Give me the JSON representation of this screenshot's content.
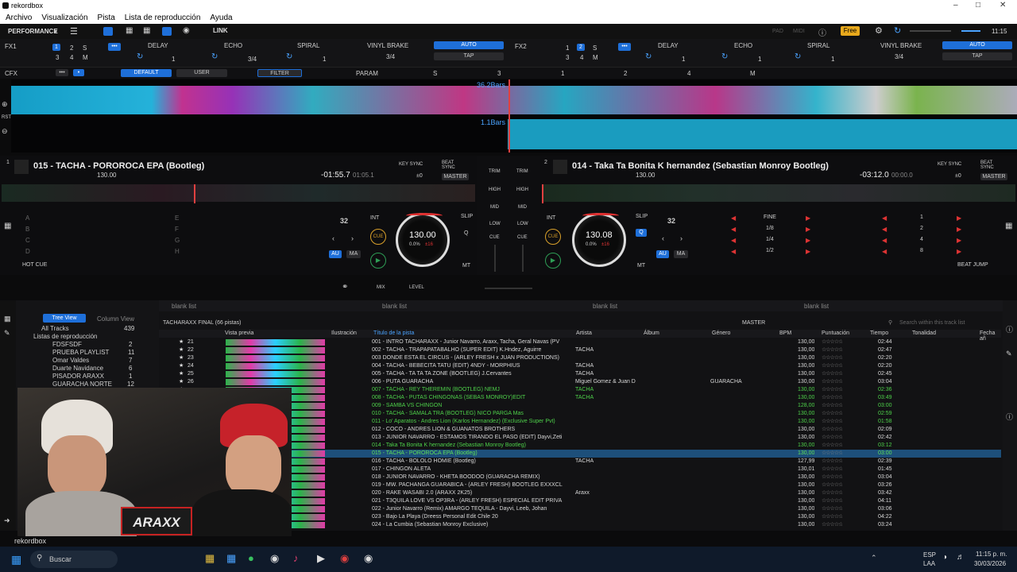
{
  "window": {
    "title": "rekordbox"
  },
  "menu": [
    "Archivo",
    "Visualización",
    "Pista",
    "Lista de reproducción",
    "Ayuda"
  ],
  "toolbar": {
    "mode": "PERFORMANCE",
    "link": "LINK",
    "pad": "PAD",
    "midi": "MIDI",
    "free": "Free",
    "time": "11:15"
  },
  "fx1": {
    "label": "FX1",
    "slots": [
      "DELAY",
      "ECHO",
      "SPIRAL"
    ],
    "beat": "3/4",
    "brake": "VINYL BRAKE",
    "auto": "AUTO",
    "tap": "TAP",
    "nums": [
      "1",
      "2",
      "S",
      "3",
      "4",
      "M"
    ],
    "vals": [
      "1",
      "3/4",
      "1"
    ]
  },
  "fx2": {
    "label": "FX2",
    "slots": [
      "DELAY",
      "ECHO",
      "SPIRAL"
    ],
    "beat": "3/4",
    "brake": "VINYL BRAKE",
    "auto": "AUTO",
    "tap": "TAP",
    "nums": [
      "1",
      "2",
      "S",
      "3",
      "4",
      "M"
    ],
    "vals": [
      "1",
      "1",
      "1"
    ]
  },
  "cfx": {
    "label": "CFX",
    "default": "DEFAULT",
    "user": "USER",
    "filter": "FILTER",
    "param": "PARAM",
    "s": "S",
    "n3": "3",
    "n1": "1",
    "n2": "2",
    "n4": "4",
    "m": "M"
  },
  "wave": {
    "bars1": "36.2Bars",
    "bars2": "1.1Bars",
    "rst": "RST"
  },
  "deckA": {
    "num": "1",
    "title": "015 - TACHA - POROROCA EPA (Bootleg)",
    "bpm": "130.00",
    "time": "-01:55.7",
    "time2": "01:05.1",
    "keysync": "KEY SYNC",
    "beatsync": "BEAT SYNC",
    "master": "MASTER",
    "key": "±0",
    "loop": "32",
    "int": "INT",
    "jog_bpm": "130.00",
    "jog_pct": "0.0%",
    "jog_range": "±16",
    "slip": "SLIP",
    "q": "Q",
    "cue": "CUE",
    "au": "AU",
    "ma": "MA",
    "mt": "MT",
    "hotcue": "HOT CUE",
    "pads": [
      "A",
      "B",
      "C",
      "D",
      "E",
      "F",
      "G",
      "H"
    ]
  },
  "deckB": {
    "num": "2",
    "title": "014 - Taka Ta Bonita K hernandez (Sebastian Monroy Bootleg)",
    "bpm": "130.00",
    "time": "-03:12.0",
    "time2": "00:00.0",
    "keysync": "KEY SYNC",
    "beatsync": "BEAT SYNC",
    "master": "MASTER",
    "key": "±0",
    "loop": "32",
    "int": "INT",
    "jog_bpm": "130.08",
    "jog_pct": "0.0%",
    "jog_range": "±16",
    "slip": "SLIP",
    "q": "Q",
    "cue": "CUE",
    "au": "AU",
    "ma": "MA",
    "mt": "MT",
    "beatjump": "BEAT JUMP",
    "jumps_left": [
      "FINE",
      "1/8",
      "1/4",
      "1/2"
    ],
    "jumps_right": [
      "1",
      "2",
      "4",
      "8"
    ]
  },
  "mixer": {
    "trim": "TRIM",
    "high": "HIGH",
    "mid": "MID",
    "low": "LOW",
    "cue": "CUE",
    "mix": "MIX",
    "level": "LEVEL"
  },
  "browser": {
    "tree_view": "Tree View",
    "column_view": "Column View",
    "tree": [
      {
        "name": "All Tracks",
        "count": "439"
      },
      {
        "name": "Listas de reproducción",
        "count": ""
      },
      {
        "name": "FDSFSDF",
        "count": "2"
      },
      {
        "name": "PRUEBA PLAYLIST",
        "count": "11"
      },
      {
        "name": "Omar Valdes",
        "count": "7"
      },
      {
        "name": "Duarte Navidance",
        "count": "6"
      },
      {
        "name": "PISADOR ARAXX",
        "count": "1"
      },
      {
        "name": "GUARACHA NORTE",
        "count": "12"
      }
    ],
    "panes": [
      "blank list",
      "blank list",
      "blank list",
      "blank list"
    ],
    "list_title": "TACHARAXX FINAL (66 pistas)",
    "master": "MASTER",
    "search": "Search within this track list",
    "cols": [
      "Vista previa",
      "Ilustración",
      "Título de la pista",
      "Artista",
      "Álbum",
      "Género",
      "BPM",
      "Puntuación",
      "Tiempo",
      "Tonalidad",
      "Fecha añ"
    ],
    "rows": [
      {
        "n": "21",
        "t": "001 - INTRO TACHARAXX - Junior Navarro, Araxx, Tacha, Geral Navas (PV",
        "a": "",
        "g": "",
        "b": "130,00",
        "d": "02:44",
        "c": ""
      },
      {
        "n": "22",
        "t": "002 - TACHA - TRAPAPATABALHO (SUPER EDIT) K.Hndez, Aguirre",
        "a": "TACHA",
        "g": "",
        "b": "130,00",
        "d": "02:47",
        "c": ""
      },
      {
        "n": "23",
        "t": "003 DONDE ESTA EL CIRCUS - (ARLEY FRESH x JUAN PRODUCTIONS)",
        "a": "",
        "g": "",
        "b": "130,00",
        "d": "02:20",
        "c": ""
      },
      {
        "n": "24",
        "t": "004 - TACHA - BEBECITA TATU (EDIT) 4NDY - MORPHIUS",
        "a": "TACHA",
        "g": "",
        "b": "130,00",
        "d": "02:20",
        "c": ""
      },
      {
        "n": "25",
        "t": "005 - TACHA - TA TA TA ZONE (BOOTLEG) J.Cervantes",
        "a": "TACHA",
        "g": "",
        "b": "130,00",
        "d": "02:45",
        "c": ""
      },
      {
        "n": "26",
        "t": "006 - PUTA GUARACHA",
        "a": "Miguel Gomez & Juan D",
        "g": "GUARACHA",
        "b": "130,00",
        "d": "03:04",
        "c": ""
      },
      {
        "n": "",
        "t": "007 - TACHA - REY THEREMIN (BOOTLEG) NEMJ",
        "a": "TACHA",
        "g": "",
        "b": "130,00",
        "d": "02:36",
        "c": "g"
      },
      {
        "n": "",
        "t": "008 - TACHA - PUTAS CHINGONAS (SEBAS MONROY)EDIT",
        "a": "TACHA",
        "g": "",
        "b": "130,00",
        "d": "03:49",
        "c": "g"
      },
      {
        "n": "",
        "t": "009 - SAMBA VS CHINGON",
        "a": "",
        "g": "",
        "b": "128,00",
        "d": "03:00",
        "c": "g"
      },
      {
        "n": "",
        "t": "010 - TACHA - SAMALA TRA (BOOTLEG) NICO PARGA Mas",
        "a": "",
        "g": "",
        "b": "130,00",
        "d": "02:59",
        "c": "g"
      },
      {
        "n": "",
        "t": "011 - Lo' Aparatos - Andres Lion (Karlos Hernandez) (Exclusive Super Pvt)",
        "a": "",
        "g": "",
        "b": "130,00",
        "d": "01:58",
        "c": "g"
      },
      {
        "n": "",
        "t": "012 - COCO - ANDRES LION & GUANATOS BROTHERS",
        "a": "",
        "g": "",
        "b": "130,00",
        "d": "02:09",
        "c": ""
      },
      {
        "n": "",
        "t": "013 - JUNIOR NAVARRO - ESTAMOS TIRANDO EL PASO (EDIT) Dayvi,Zeti",
        "a": "",
        "g": "",
        "b": "130,00",
        "d": "02:42",
        "c": ""
      },
      {
        "n": "",
        "t": "014 - Taka Ta Bonita K hernandez (Sebastian Monroy Bootleg)",
        "a": "",
        "g": "",
        "b": "130,00",
        "d": "03:12",
        "c": "g"
      },
      {
        "n": "",
        "t": "015 - TACHA - POROROCA EPA (Bootleg)",
        "a": "",
        "g": "",
        "b": "130,00",
        "d": "03:00",
        "c": "sel"
      },
      {
        "n": "",
        "t": "016 - TACHA - BOLOLO HOMIE (Bootleg)",
        "a": "TACHA",
        "g": "",
        "b": "127,99",
        "d": "02:39",
        "c": ""
      },
      {
        "n": "",
        "t": "017 - CHINGON ALETA",
        "a": "",
        "g": "",
        "b": "130,01",
        "d": "01:45",
        "c": ""
      },
      {
        "n": "",
        "t": "018 - JUNIOR NAVARRO - KHETA BOODOO (GUARACHA REMIX)",
        "a": "",
        "g": "",
        "b": "130,00",
        "d": "03:04",
        "c": ""
      },
      {
        "n": "",
        "t": "019 - MW. PACHANGA GUARABICA - (ARLEY FRESH) BOOTLEG EXXXCL",
        "a": "",
        "g": "",
        "b": "130,00",
        "d": "03:26",
        "c": ""
      },
      {
        "n": "",
        "t": "020 - RAKE WASABI 2.0 (ARAXX 2K25)",
        "a": "Araxx",
        "g": "",
        "b": "130,00",
        "d": "03:42",
        "c": ""
      },
      {
        "n": "",
        "t": "021 - T3QUILA LOVE VS OP3RA - (ARLEY FRESH) ESPECIAL EDIT PRIVA",
        "a": "",
        "g": "",
        "b": "130,00",
        "d": "04:11",
        "c": ""
      },
      {
        "n": "",
        "t": "022 - Junior Navarro (Remix) AMARGO TEQUILA - Dayvi, Leeb, Johan",
        "a": "",
        "g": "",
        "b": "130,00",
        "d": "03:06",
        "c": ""
      },
      {
        "n": "",
        "t": "023 - Bajo La Playa (Dreess Personal Edit Chile 20",
        "a": "",
        "g": "",
        "b": "130,00",
        "d": "04:22",
        "c": ""
      },
      {
        "n": "",
        "t": "024 - La Cumbia (Sebastian Monroy Exclusive)",
        "a": "",
        "g": "",
        "b": "130,00",
        "d": "03:24",
        "c": ""
      }
    ]
  },
  "brand": "rekordbox",
  "webcam": {
    "logo": "ARAXX"
  },
  "taskbar": {
    "search": "Buscar",
    "lang1": "ESP",
    "lang2": "LAA",
    "time": "11:15 p. m.",
    "date": "30/03/2026"
  }
}
